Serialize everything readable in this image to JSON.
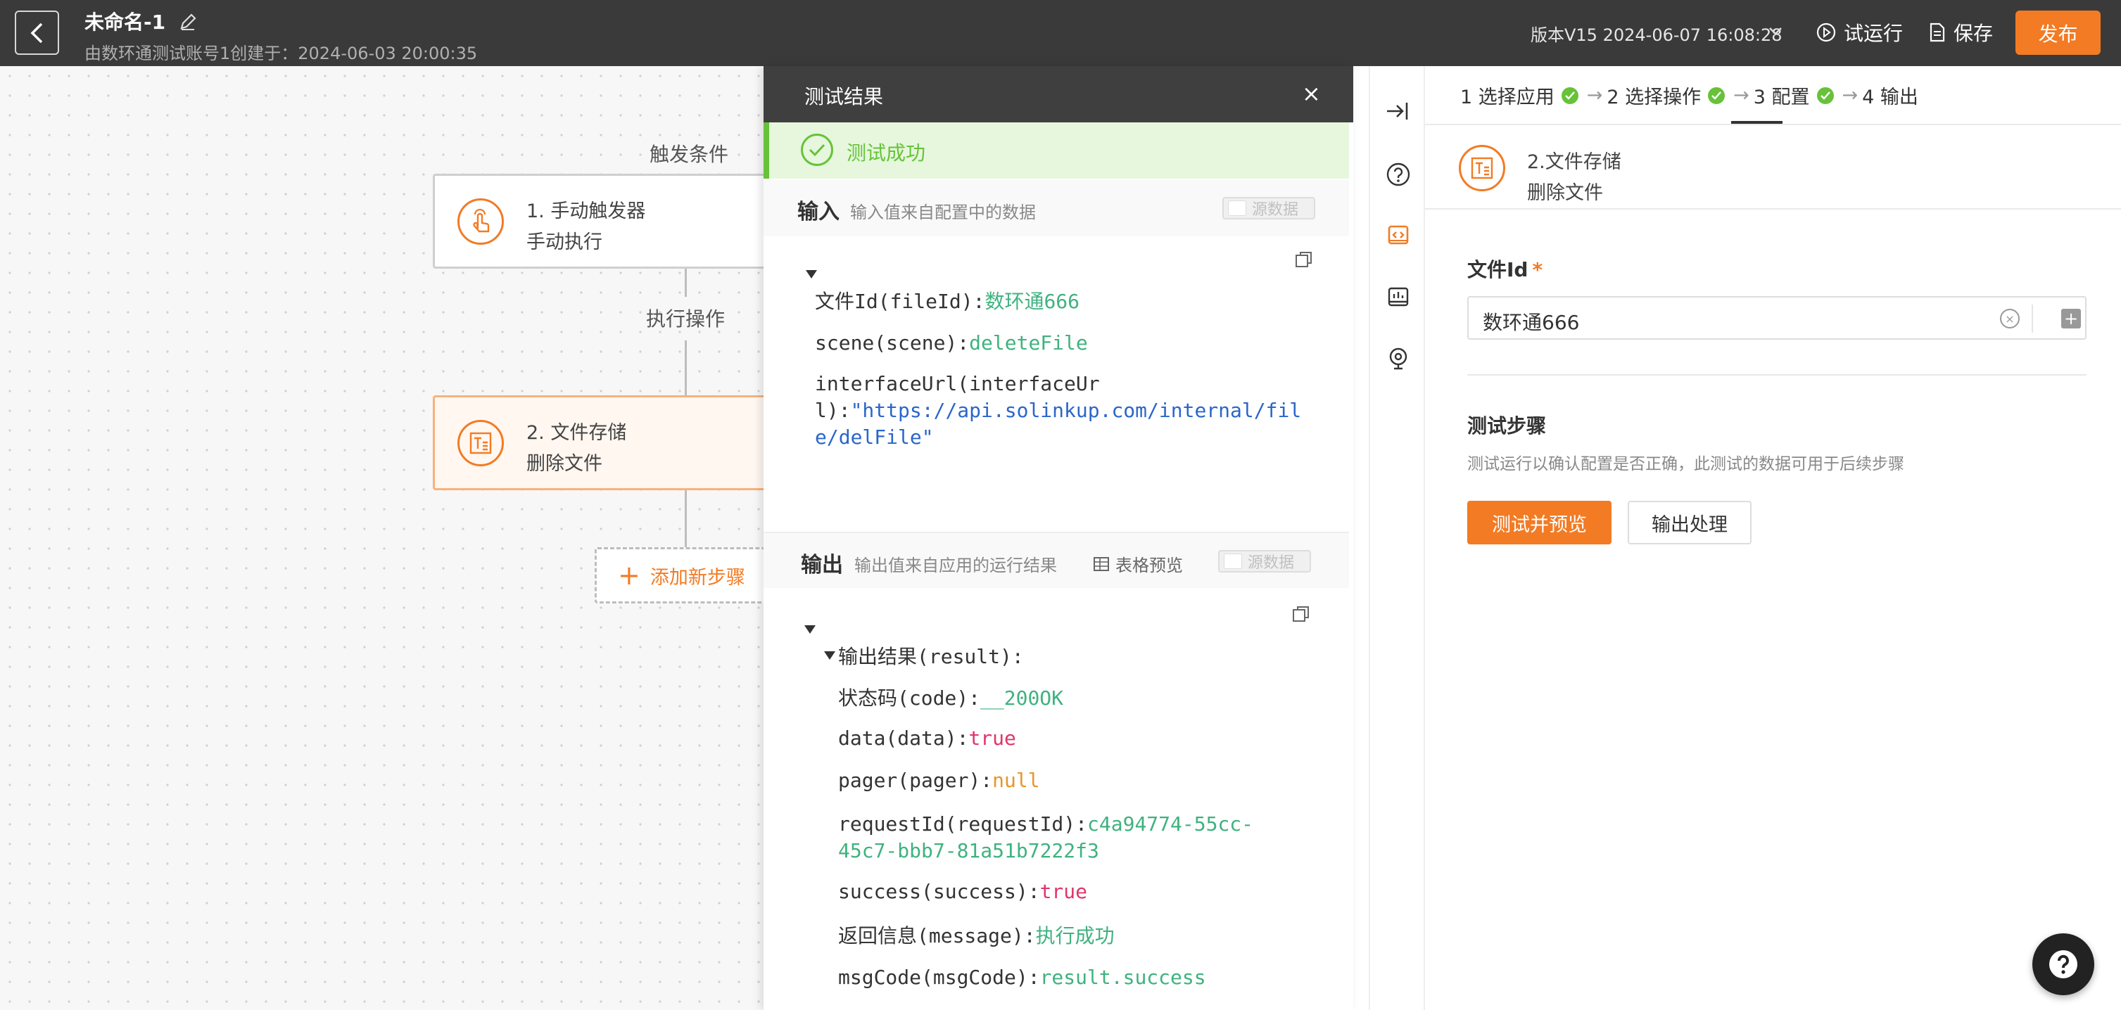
{
  "header": {
    "title": "未命名-1",
    "subtitle": "由数环通测试账号1创建于：2024-06-03 20:00:35",
    "version": "版本V15 2024-06-07 16:08:28",
    "run_label": "试运行",
    "save_label": "保存",
    "publish_label": "发布"
  },
  "canvas": {
    "trigger_label": "触发条件",
    "action_label": "执行操作",
    "node1": {
      "title": "1. 手动触发器",
      "subtitle": "手动执行"
    },
    "node2": {
      "title": "2. 文件存储",
      "subtitle": "删除文件"
    },
    "add_step_label": "添加新步骤"
  },
  "test_panel": {
    "title": "测试结果",
    "success_text": "测试成功",
    "input": {
      "title": "输入",
      "desc": "输入值来自配置中的数据",
      "toggle_label": "源数据",
      "fields": [
        {
          "key": "文件Id(fileId):",
          "value": "数环通666"
        },
        {
          "key": "scene(scene):",
          "value": "deleteFile"
        },
        {
          "key_line1": "interfaceUrl(interfaceUr",
          "key_line2": "l):",
          "value_line1": "\"https://api.solinkup.com/internal/fil",
          "value_line2": "e/delFile\""
        }
      ]
    },
    "output": {
      "title": "输出",
      "desc": "输出值来自应用的运行结果",
      "table_preview": "表格预览",
      "toggle_label": "源数据",
      "result_key": "输出结果(result):",
      "fields": [
        {
          "key": "状态码(code):",
          "value": "__200OK"
        },
        {
          "key": "data(data):",
          "value": "true"
        },
        {
          "key": "pager(pager):",
          "value": "null"
        },
        {
          "key": "requestId(requestId):",
          "value_line1": "c4a94774-55cc-",
          "value_line2": "45c7-bbb7-81a51b7222f3"
        },
        {
          "key": "success(success):",
          "value": "true"
        },
        {
          "key": "返回信息(message):",
          "value": "执行成功"
        },
        {
          "key": "msgCode(msgCode):",
          "value": "result.success"
        }
      ]
    }
  },
  "config": {
    "steps": [
      "1 选择应用",
      "2 选择操作",
      "3 配置",
      "4 输出"
    ],
    "app_title": "2.文件存储",
    "app_action": "删除文件",
    "field_label": "文件Id",
    "required_mark": "*",
    "field_value": "数环通666",
    "test_title": "测试步骤",
    "test_desc": "测试运行以确认配置是否正确，此测试的数据可用于后续步骤",
    "test_btn": "测试并预览",
    "output_btn": "输出处理"
  },
  "colors": {
    "accent": "#f27b24",
    "success": "#67c23a",
    "header_bg": "#3a3a3a"
  }
}
